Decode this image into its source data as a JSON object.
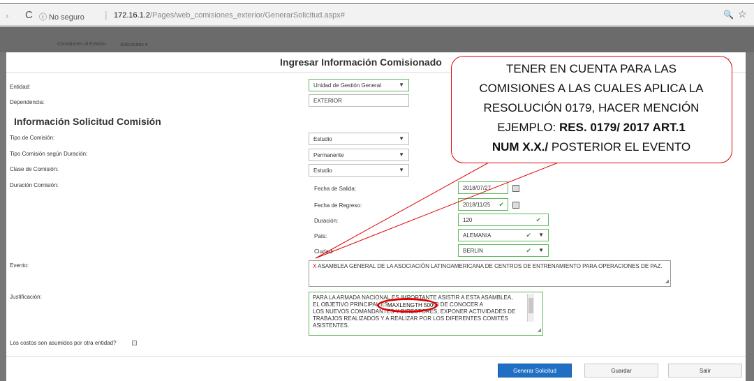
{
  "browser": {
    "nav_arrow": "›",
    "reload_icon": "C",
    "security": "ⓘ No seguro",
    "url_host": "172.16.1.2",
    "url_path": "/Pages/web_comisiones_exterior/GenerarSolicitud.aspx#",
    "zoom_icon": "🔍",
    "star_icon": "☆"
  },
  "bgnav": {
    "items": [
      "Comisiones al Exterior",
      "Solicitudes ▾"
    ]
  },
  "modal": {
    "title": "Ingresar Información Comisionado",
    "close": "×",
    "entidad_label": "Entidad:",
    "entidad_value": "Unidad de Gestión General",
    "dependencia_label": "Dependencia:",
    "dependencia_value": "EXTERIOR",
    "section_title": "Información Solicitud Comisión",
    "tipo_label": "Tipo de Comisión:",
    "tipo_value": "Estudio",
    "tipo_duracion_label": "Tipo Comisión según Duración:",
    "tipo_duracion_value": "Permanente",
    "clase_label": "Clase de Comisión:",
    "clase_value": "Estudio",
    "duracion_comision_label": "Duración Comisión:",
    "fecha_salida_label": "Fecha de Salida:",
    "fecha_salida_value": "2018/07/27",
    "fecha_regreso_label": "Fecha de Regreso:",
    "fecha_regreso_value": "2018/11/25",
    "duracion_label": "Duración:",
    "duracion_value": "120",
    "pais_label": "País:",
    "pais_value": "ALEMANIA",
    "ciudad_label": "Ciudad:",
    "ciudad_value": "BERLIN",
    "evento_label": "Evento:",
    "evento_marker": "X",
    "evento_value": " ASAMBLEA GENERAL DE LA ASOCIACIÓN LATINOAMERICANA DE CENTROS DE ENTRENAMIENTO PARA OPERACIONES DE PAZ.",
    "justificacion_label": "Justificación:",
    "justificacion_lines": [
      "PARA LA ARMADA NACIONAL ES IMPORTANTE ASISTIR A ESTA ASAMBLEA,",
      "EL OBJETIVO PRINCIPAL ES LA OPORTUNIDAD DE CONOCER A",
      "LOS NUEVOS COMANDANTES Y DIRECTORES, EXPONER ACTIVIDADES DE",
      "TRABAJOS REALIZADOS Y A REALIZAR POR LOS DIFERENTES COMITÉS",
      "ASISTENTES."
    ],
    "maxlength_label": "MAXLENGTH 500",
    "costos_label": "Los costos son asumidos por otra entidad?",
    "btn_generar": "Generar Solicitud",
    "btn_guardar": "Guardar",
    "btn_salir": "Salir"
  },
  "callout": {
    "lines": [
      "TENER  EN CUENTA PARA LAS",
      "COMISIONES A LAS CUALES APLICA LA",
      "RESOLUCIÓN 0179, HACER MENCIÓN"
    ],
    "line4_plain": "EJEMPLO: ",
    "line4_bold": "RES. 0179/ 2017  ART.1",
    "line5_bold": "NUM X.X./",
    "line5_plain": " POSTERIOR EL EVENTO"
  },
  "colors": {
    "annotation_red": "#e00000",
    "valid_green": "#5cb85c",
    "primary_blue": "#1f6fc5"
  }
}
